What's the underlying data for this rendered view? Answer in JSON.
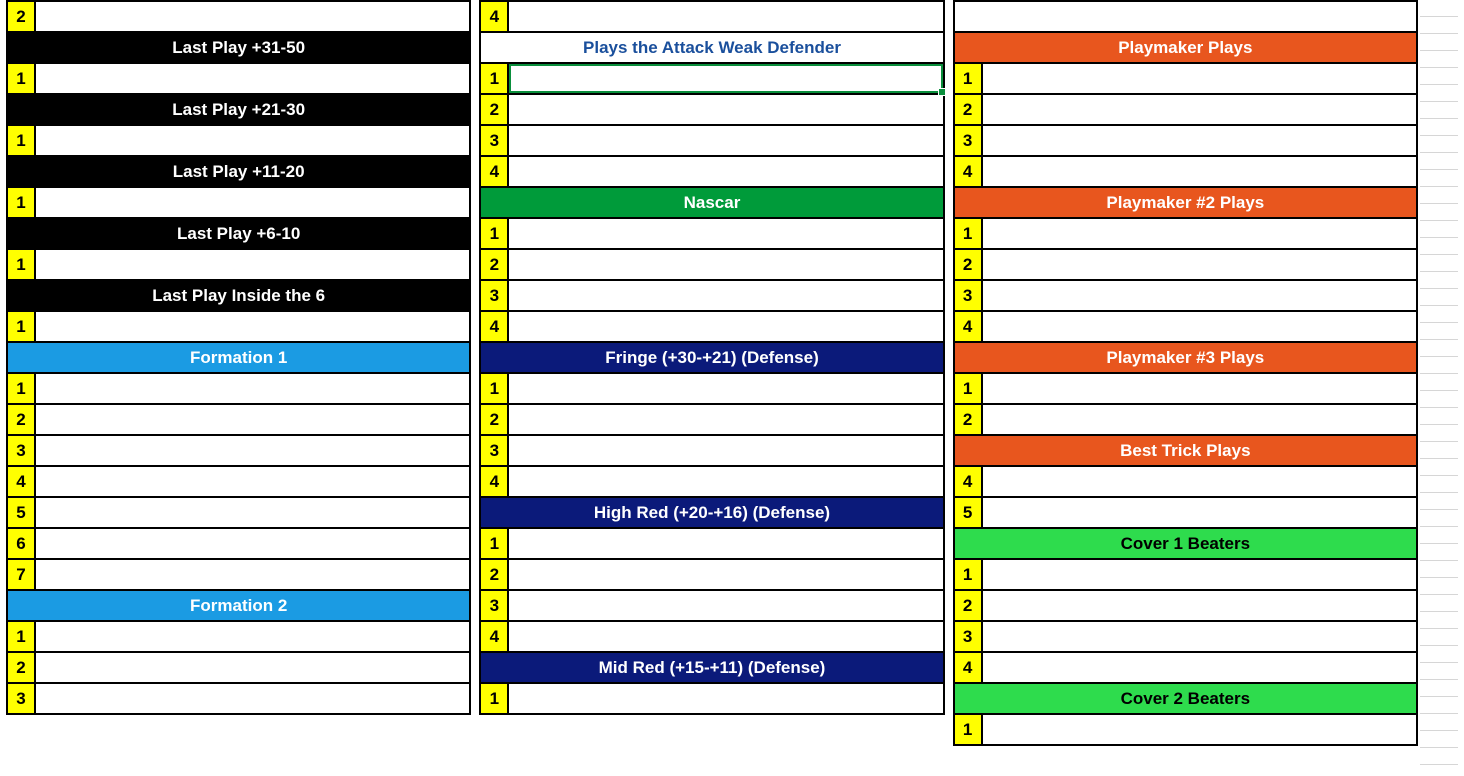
{
  "colA": {
    "topNum": "2",
    "sections": [
      {
        "header": "Last Play +31-50",
        "rows": [
          "1"
        ]
      },
      {
        "header": "Last Play +21-30",
        "rows": [
          "1"
        ]
      },
      {
        "header": "Last Play +11-20",
        "rows": [
          "1"
        ]
      },
      {
        "header": "Last Play +6-10",
        "rows": [
          "1"
        ]
      },
      {
        "header": "Last Play Inside the 6",
        "rows": [
          "1"
        ]
      }
    ],
    "formation1": {
      "header": "Formation 1",
      "rows": [
        "1",
        "2",
        "3",
        "4",
        "5",
        "6",
        "7"
      ]
    },
    "formation2": {
      "header": "Formation 2",
      "rows": [
        "1",
        "2",
        "3"
      ]
    }
  },
  "colB": {
    "topNum": "4",
    "attackHeader": "Plays the Attack Weak Defender",
    "attackRows": [
      "1",
      "2",
      "3",
      "4"
    ],
    "nascarHeader": "Nascar",
    "nascarRows": [
      "1",
      "2",
      "3",
      "4"
    ],
    "fringe": {
      "header": "Fringe (+30-+21) (Defense)",
      "rows": [
        "1",
        "2",
        "3",
        "4"
      ]
    },
    "highred": {
      "header": "High Red (+20-+16) (Defense)",
      "rows": [
        "1",
        "2",
        "3",
        "4"
      ]
    },
    "midred": {
      "header": "Mid Red (+15-+11) (Defense)",
      "rows": [
        "1"
      ]
    }
  },
  "colC": {
    "playmaker": {
      "header": "Playmaker Plays",
      "rows": [
        "1",
        "2",
        "3",
        "4"
      ]
    },
    "playmaker2": {
      "header": "Playmaker #2 Plays",
      "rows": [
        "1",
        "2",
        "3",
        "4"
      ]
    },
    "playmaker3": {
      "header": "Playmaker #3 Plays",
      "rows": [
        "1",
        "2"
      ]
    },
    "trick": {
      "header": "Best Trick Plays",
      "rows": [
        "4",
        "5"
      ]
    },
    "cover1": {
      "header": "Cover 1 Beaters",
      "rows": [
        "1",
        "2",
        "3",
        "4"
      ]
    },
    "cover2": {
      "header": "Cover 2 Beaters",
      "rows": [
        "1"
      ]
    }
  }
}
